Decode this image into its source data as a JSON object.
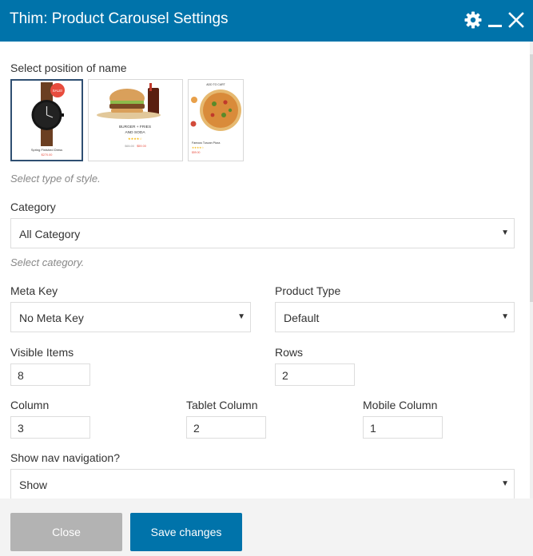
{
  "dialog": {
    "title": "Thim: Product Carousel Settings"
  },
  "layout_section": {
    "label": "Select position of name",
    "hint": "Select type of style.",
    "options": [
      {
        "name": "Spring Finished Dress",
        "price": "$270.00",
        "badge": "SALE!"
      },
      {
        "name": "BURGER + FRIES AND SODA",
        "price": "$59.00",
        "old_price": "$65.00"
      },
      {
        "name": "Famous Tuscan Pizza",
        "price": "$59.00",
        "button": "ADD TO CART"
      }
    ]
  },
  "category": {
    "label": "Category",
    "value": "All Category",
    "hint": "Select category."
  },
  "meta_key": {
    "label": "Meta Key",
    "value": "No Meta Key"
  },
  "product_type": {
    "label": "Product Type",
    "value": "Default"
  },
  "visible_items": {
    "label": "Visible Items",
    "value": "8"
  },
  "rows": {
    "label": "Rows",
    "value": "2"
  },
  "column": {
    "label": "Column",
    "value": "3"
  },
  "tablet_column": {
    "label": "Tablet Column",
    "value": "2"
  },
  "mobile_column": {
    "label": "Mobile Column",
    "value": "1"
  },
  "nav": {
    "label": "Show nav navigation?",
    "value": "Show"
  },
  "footer": {
    "close_label": "Close",
    "save_label": "Save changes"
  },
  "colors": {
    "accent": "#0073aa",
    "close_button": "#b3b3b3",
    "footer_bg": "#f3f3f3",
    "sale_badge": "#e84c3d"
  },
  "icons": {
    "settings": "gear-icon",
    "minimize": "minimize-icon",
    "close": "close-icon",
    "dropdown": "caret-down-icon"
  }
}
